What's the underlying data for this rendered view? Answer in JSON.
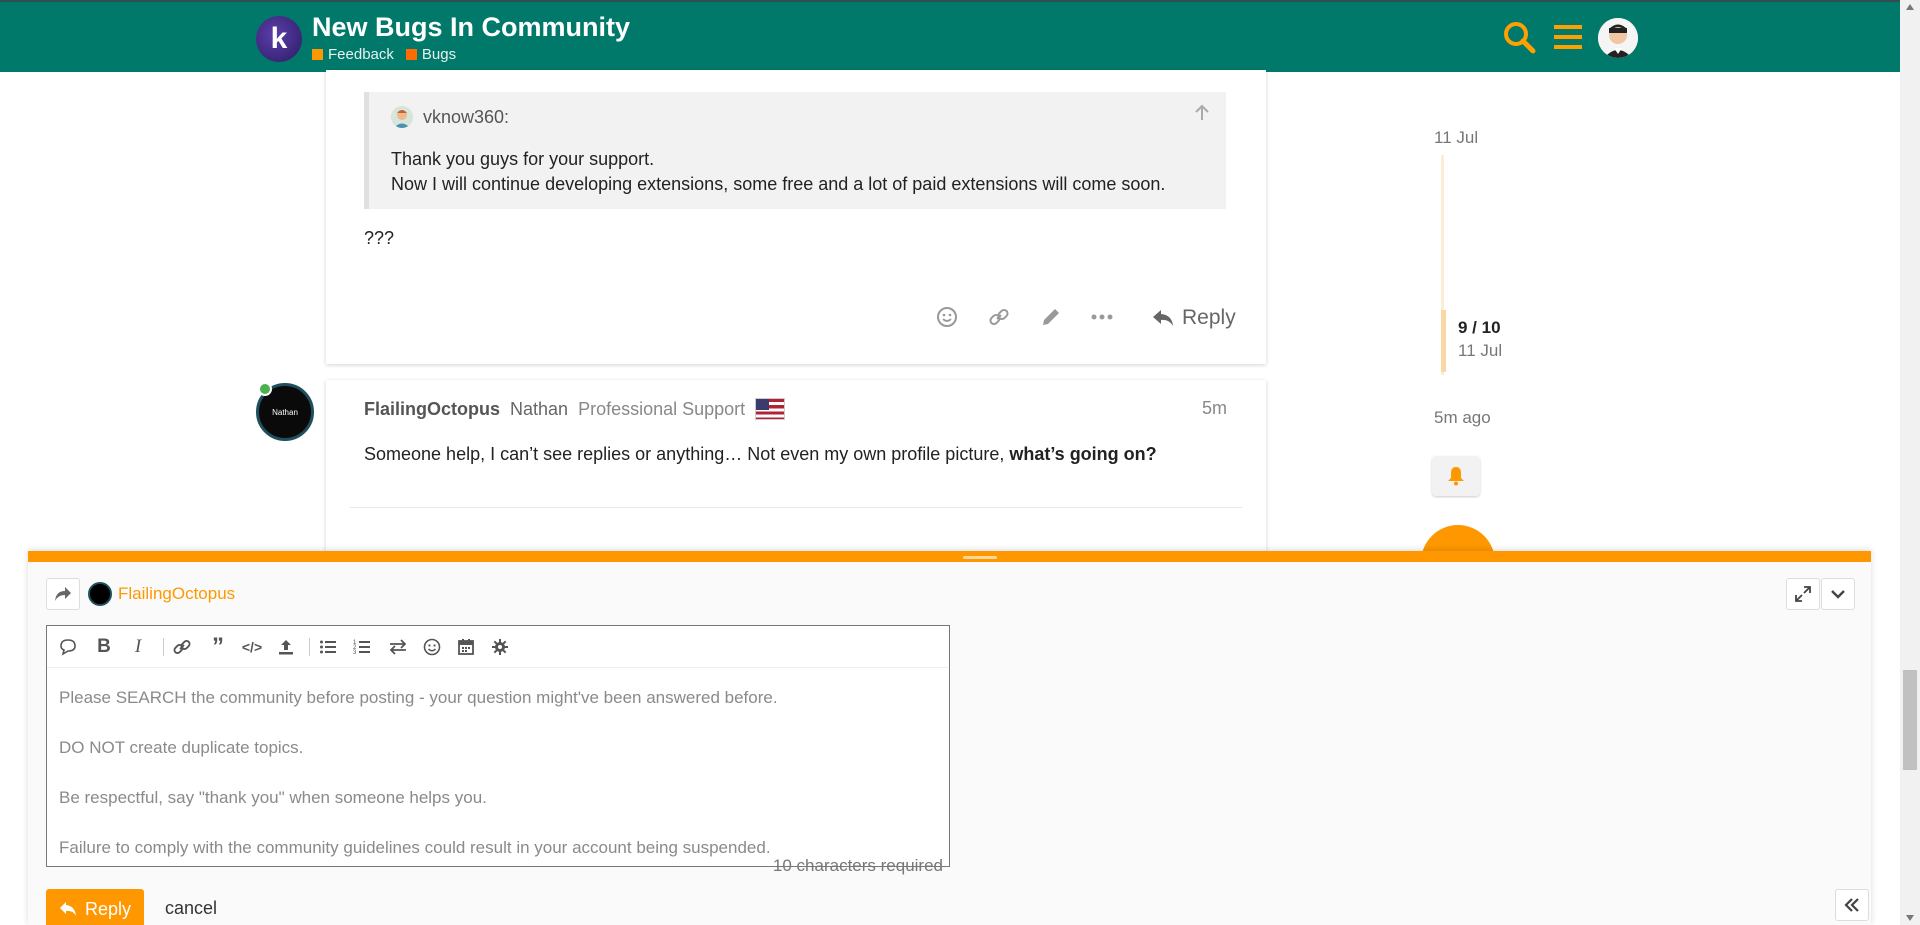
{
  "header": {
    "logo_letter": "k",
    "title": "New Bugs In Community",
    "breadcrumbs": [
      {
        "label": "Feedback",
        "color": "#ff9800"
      },
      {
        "label": "Bugs",
        "color": "#ff6b00"
      }
    ],
    "icons": [
      "search-icon",
      "hamburger-menu-icon",
      "user-avatar"
    ],
    "accent_color": "#00796b",
    "icon_color": "#ffa000"
  },
  "quote": {
    "username": "vknow360:",
    "line1": "Thank you guys for your support.",
    "line2": "Now I will continue developing extensions, some free and a lot of paid extensions will come soon."
  },
  "post1": {
    "text": "???",
    "reply_label": "Reply"
  },
  "post2": {
    "username": "FlailingOctopus",
    "name": "Nathan",
    "title": "Professional Support",
    "time": "5m",
    "avatar_text": "Nathan",
    "text_plain": "Someone help, I can’t see replies or anything… Not even my own profile picture, ",
    "text_bold": "what’s going on?"
  },
  "timeline": {
    "top_date": "11 Jul",
    "position": "9 / 10",
    "position_date": "11 Jul",
    "last_activity": "5m ago"
  },
  "composer": {
    "username": "FlailingOctopus",
    "placeholder_lines": [
      "Please SEARCH the community before posting - your question might've been answered before.",
      "DO NOT create duplicate topics.",
      "Be respectful, say \"thank you\" when someone helps you.",
      "Failure to comply with the community guidelines could result in your account being suspended."
    ],
    "chars_required": "10 characters required",
    "reply_label": "Reply",
    "cancel_label": "cancel",
    "brand_color": "#ff9800"
  }
}
